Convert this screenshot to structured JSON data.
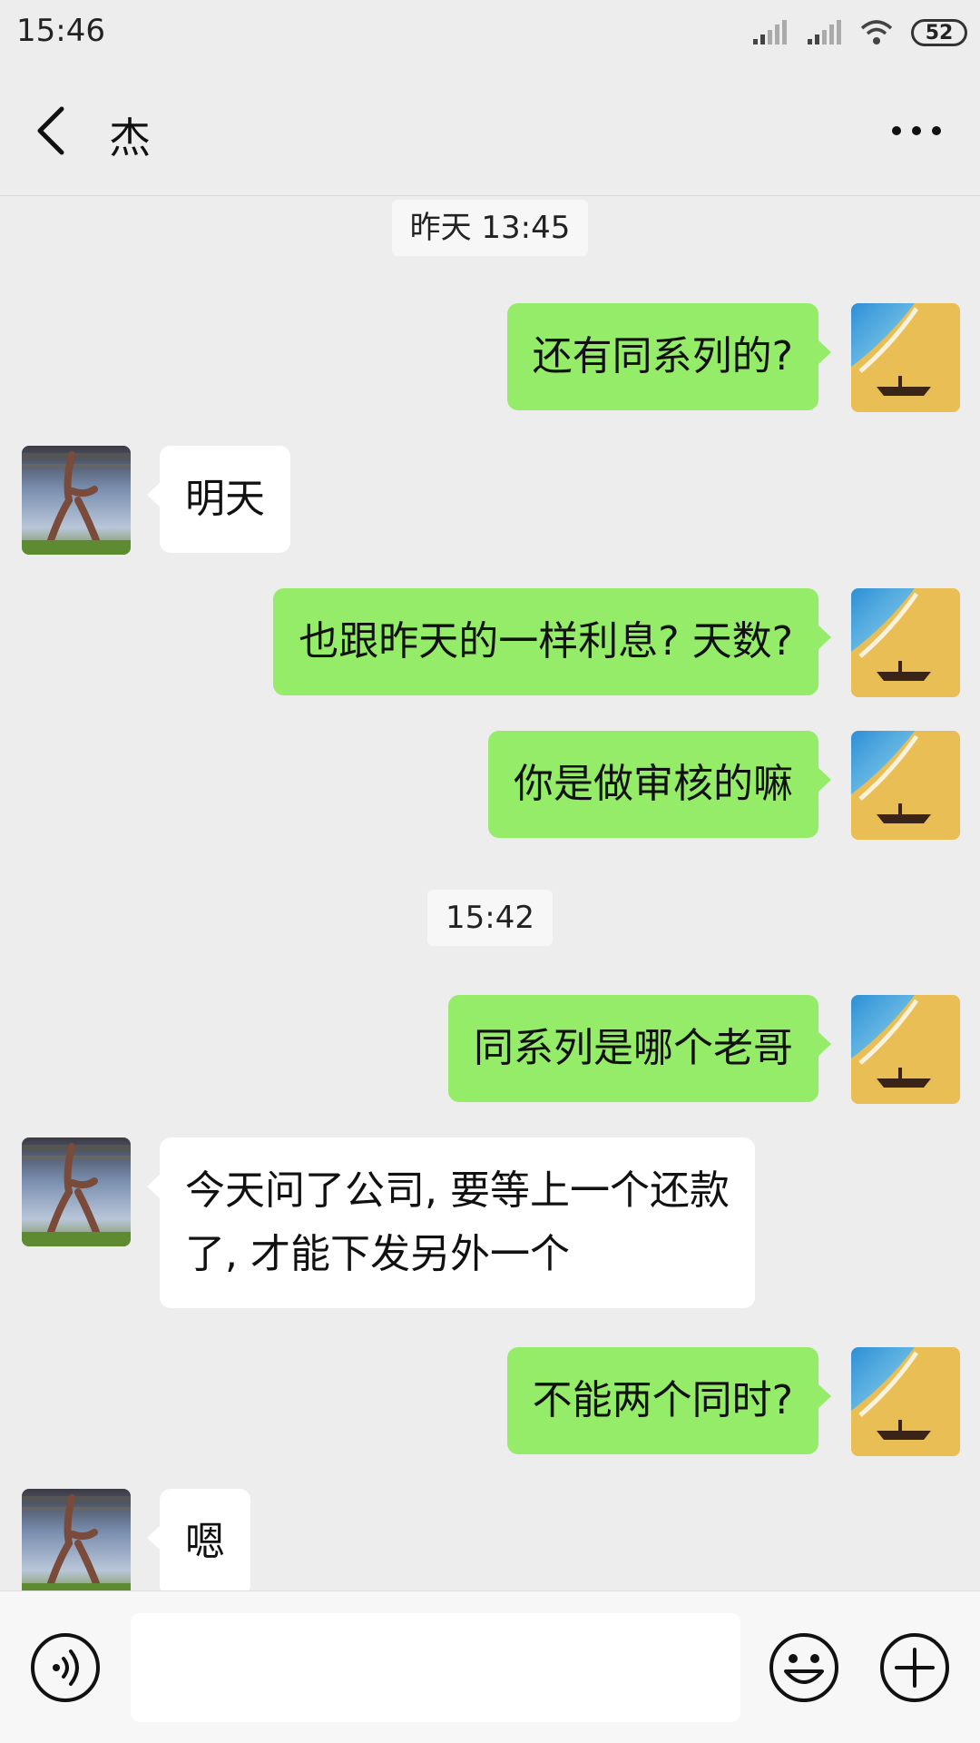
{
  "status_bar": {
    "time": "15:46",
    "battery": "52"
  },
  "header": {
    "title": "杰"
  },
  "messages": [
    {
      "type": "timestamp",
      "text": "昨天 13:45"
    },
    {
      "type": "msg",
      "side": "right",
      "text": "还有同系列的?"
    },
    {
      "type": "msg",
      "side": "left",
      "text": "明天"
    },
    {
      "type": "msg",
      "side": "right",
      "text": "也跟昨天的一样利息? 天数?"
    },
    {
      "type": "msg",
      "side": "right",
      "text": "你是做审核的嘛"
    },
    {
      "type": "timestamp",
      "text": "15:42"
    },
    {
      "type": "msg",
      "side": "right",
      "text": "同系列是哪个老哥"
    },
    {
      "type": "msg",
      "side": "left",
      "text": "今天问了公司, 要等上一个还款\n了, 才能下发另外一个"
    },
    {
      "type": "msg",
      "side": "right",
      "text": "不能两个同时?"
    },
    {
      "type": "msg",
      "side": "left",
      "text": "嗯"
    }
  ],
  "input": {
    "value": ""
  },
  "icons": {
    "back": "back-arrow-icon",
    "more": "more-dots-icon",
    "voice": "voice-icon",
    "emoji": "emoji-icon",
    "plus": "plus-icon"
  },
  "colors": {
    "background": "#EDEDED",
    "sent_bubble": "#95EC69",
    "received_bubble": "#FFFFFF",
    "timestamp_bg": "#F7F7F7"
  }
}
